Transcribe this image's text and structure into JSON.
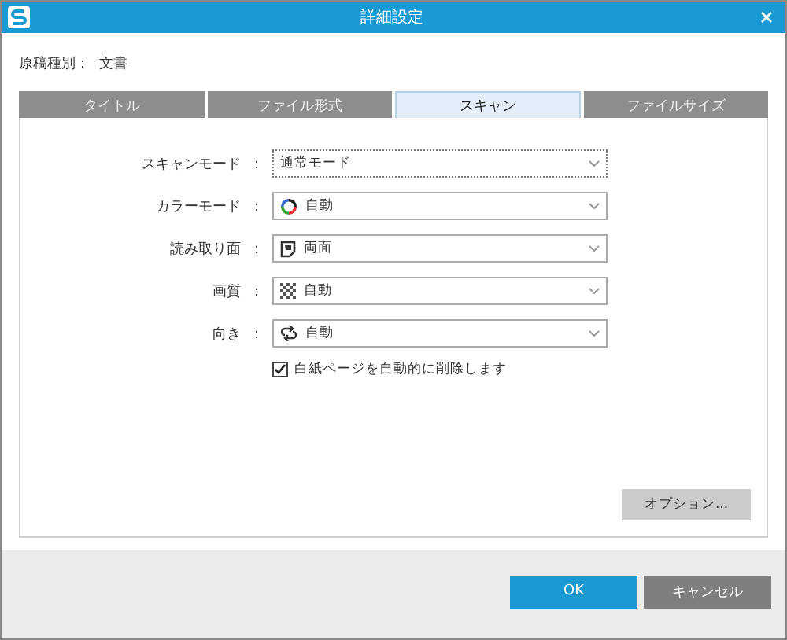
{
  "window": {
    "title": "詳細設定"
  },
  "document_type": {
    "label": "原稿種別：",
    "value": "文書"
  },
  "tabs": [
    {
      "label": "タイトル",
      "selected": false
    },
    {
      "label": "ファイル形式",
      "selected": false
    },
    {
      "label": "スキャン",
      "selected": true
    },
    {
      "label": "ファイルサイズ",
      "selected": false
    }
  ],
  "settings": [
    {
      "label": "スキャンモード",
      "separator": "：",
      "value": "通常モード",
      "kind": "plain",
      "focused": true
    },
    {
      "label": "カラーモード",
      "separator": "：",
      "value": "自動",
      "kind": "color",
      "focused": false
    },
    {
      "label": "読み取り面",
      "separator": "：",
      "value": "両面",
      "kind": "sides",
      "focused": false
    },
    {
      "label": "画質",
      "separator": "：",
      "value": "自動",
      "kind": "quality",
      "focused": false
    },
    {
      "label": "向き",
      "separator": "：",
      "value": "自動",
      "kind": "rotate",
      "focused": false
    }
  ],
  "blank_page": {
    "label": "白紙ページを自動的に削除します",
    "checked": true
  },
  "options_button": "オプション...",
  "buttons": [
    {
      "label": "OK",
      "kind": "primary"
    },
    {
      "label": "キャンセル",
      "kind": "secondary"
    }
  ]
}
